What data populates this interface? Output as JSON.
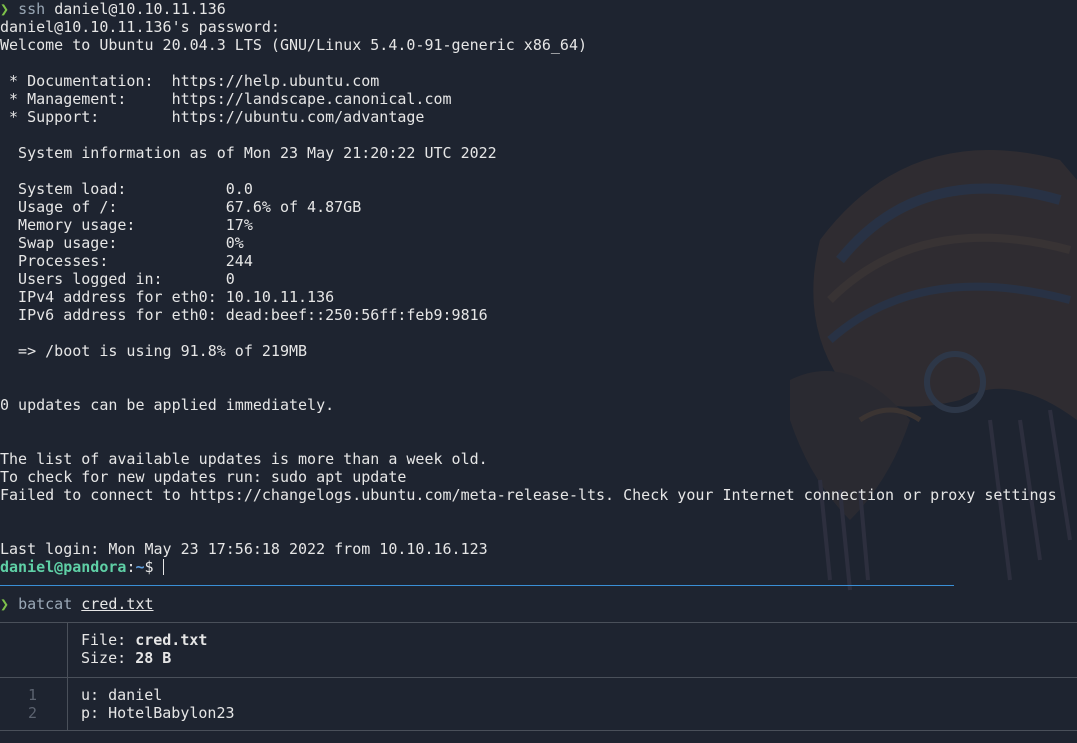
{
  "session": {
    "prompt_symbol": "❯",
    "ssh_cmd": "ssh",
    "ssh_target": "daniel@10.10.11.136",
    "output": [
      "daniel@10.10.11.136's password:",
      "Welcome to Ubuntu 20.04.3 LTS (GNU/Linux 5.4.0-91-generic x86_64)",
      "",
      " * Documentation:  https://help.ubuntu.com",
      " * Management:     https://landscape.canonical.com",
      " * Support:        https://ubuntu.com/advantage",
      "",
      "  System information as of Mon 23 May 21:20:22 UTC 2022",
      "",
      "  System load:           0.0",
      "  Usage of /:            67.6% of 4.87GB",
      "  Memory usage:          17%",
      "  Swap usage:            0%",
      "  Processes:             244",
      "  Users logged in:       0",
      "  IPv4 address for eth0: 10.10.11.136",
      "  IPv6 address for eth0: dead:beef::250:56ff:feb9:9816",
      "",
      "  => /boot is using 91.8% of 219MB",
      "",
      "",
      "0 updates can be applied immediately.",
      "",
      "",
      "The list of available updates is more than a week old.",
      "To check for new updates run: sudo apt update",
      "Failed to connect to https://changelogs.ubuntu.com/meta-release-lts. Check your Internet connection or proxy settings",
      "",
      "",
      "Last login: Mon May 23 17:56:18 2022 from 10.10.16.123"
    ],
    "remote_prompt": {
      "user_host": "daniel@pandora",
      "sep": ":",
      "path": "~",
      "symbol": "$ "
    }
  },
  "batcat": {
    "prompt_symbol": "❯",
    "cmd": "batcat",
    "arg": "cred.txt",
    "file_label": "File: ",
    "file_name": "cred.txt",
    "size_label": "Size: ",
    "size_value": "28 B",
    "lines": [
      {
        "num": "1",
        "text": "u: daniel"
      },
      {
        "num": "2",
        "text": "p: HotelBabylon23"
      }
    ]
  },
  "colors": {
    "background": "#1e2430",
    "prompt_arrow": "#7ec24a",
    "user_host": "#5fd0a6",
    "path": "#5f9fdf",
    "divider": "#3a8fd6"
  },
  "icons": {
    "background_art": "headdress-skull-wallpaper-icon"
  }
}
